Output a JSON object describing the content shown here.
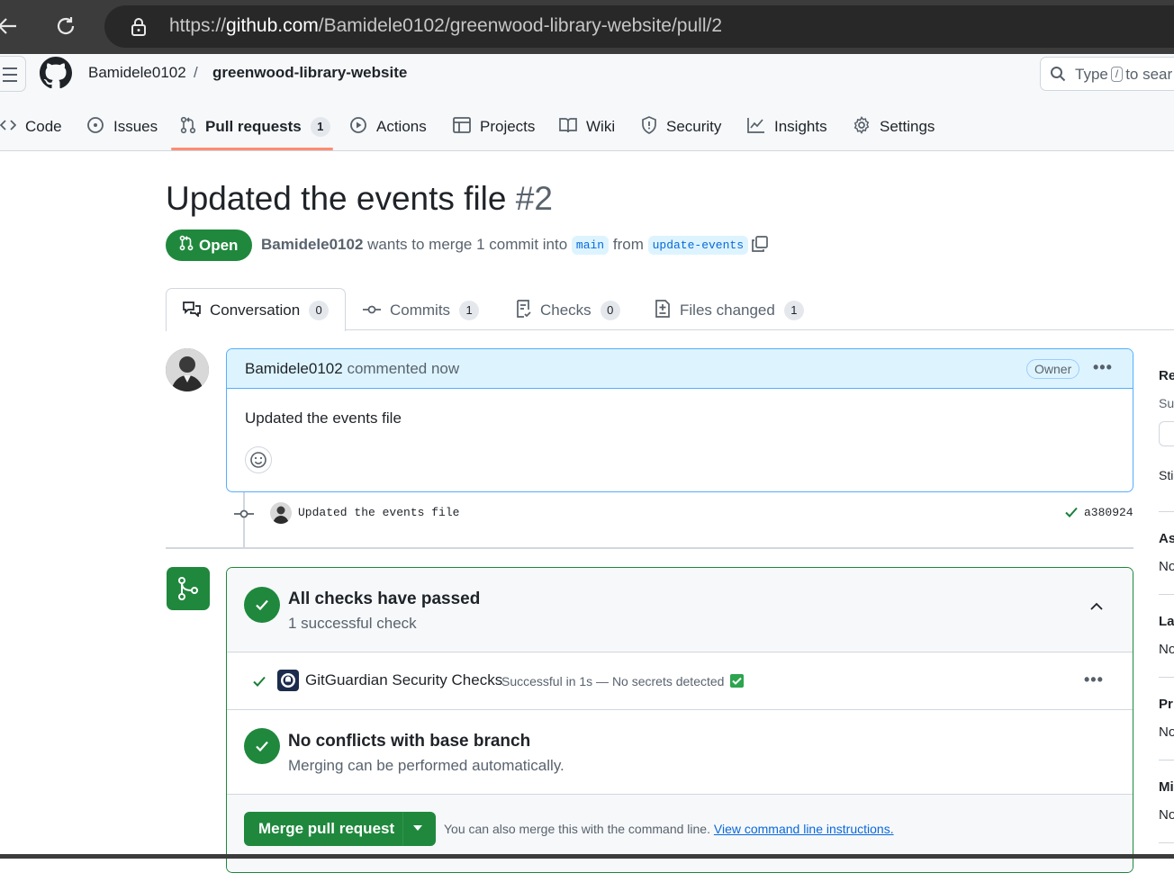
{
  "browser": {
    "url_prefix": "https://",
    "url_host": "github.com",
    "url_path": "/Bamidele0102/greenwood-library-website/pull/2"
  },
  "header": {
    "owner": "Bamidele0102",
    "separator": "/",
    "repo": "greenwood-library-website",
    "search_type": "Type",
    "search_key": "/",
    "search_rest": "to sear"
  },
  "repo_nav": [
    {
      "label": "Code",
      "icon": "code-icon"
    },
    {
      "label": "Issues",
      "icon": "issue-icon"
    },
    {
      "label": "Pull requests",
      "icon": "pull-request-icon",
      "count": "1",
      "active": true
    },
    {
      "label": "Actions",
      "icon": "play-icon"
    },
    {
      "label": "Projects",
      "icon": "table-icon"
    },
    {
      "label": "Wiki",
      "icon": "book-icon"
    },
    {
      "label": "Security",
      "icon": "shield-icon"
    },
    {
      "label": "Insights",
      "icon": "graph-icon"
    },
    {
      "label": "Settings",
      "icon": "gear-icon"
    }
  ],
  "pr": {
    "title": "Updated the events file",
    "number": "#2",
    "state": "Open",
    "author": "Bamidele0102",
    "wants_to_merge": "wants to merge 1 commit into",
    "base": "main",
    "from_word": "from",
    "head": "update-events"
  },
  "pr_tabs": [
    {
      "label": "Conversation",
      "count": "0"
    },
    {
      "label": "Commits",
      "count": "1"
    },
    {
      "label": "Checks",
      "count": "0"
    },
    {
      "label": "Files changed",
      "count": "1"
    }
  ],
  "comment": {
    "author": "Bamidele0102",
    "action": "commented now",
    "role": "Owner",
    "body": "Updated the events file"
  },
  "commit": {
    "message": "Updated the events file",
    "sha": "a380924"
  },
  "merge_box": {
    "checks_title": "All checks have passed",
    "checks_sub": "1 successful check",
    "check_name": "GitGuardian Security Checks",
    "check_status": "Successful in 1s — No secrets detected",
    "conflict_title": "No conflicts with base branch",
    "conflict_sub": "Merging can be performed automatically.",
    "merge_button": "Merge pull request",
    "hint": "You can also merge this with the command line.",
    "hint_link": "View command line instructions."
  },
  "sidebar": {
    "reviewers": "Re",
    "suggestions": "Su",
    "still": "Sti",
    "assignees": "As",
    "assignees_val": "No",
    "labels": "Lal",
    "labels_val": "No",
    "projects": "Pr",
    "projects_val": "No",
    "milestone": "Mi",
    "milestone_val": "No"
  },
  "colors": {
    "success": "#1f883d",
    "accent_blue": "#0969da",
    "active_tab_underline": "#fd8c73"
  }
}
